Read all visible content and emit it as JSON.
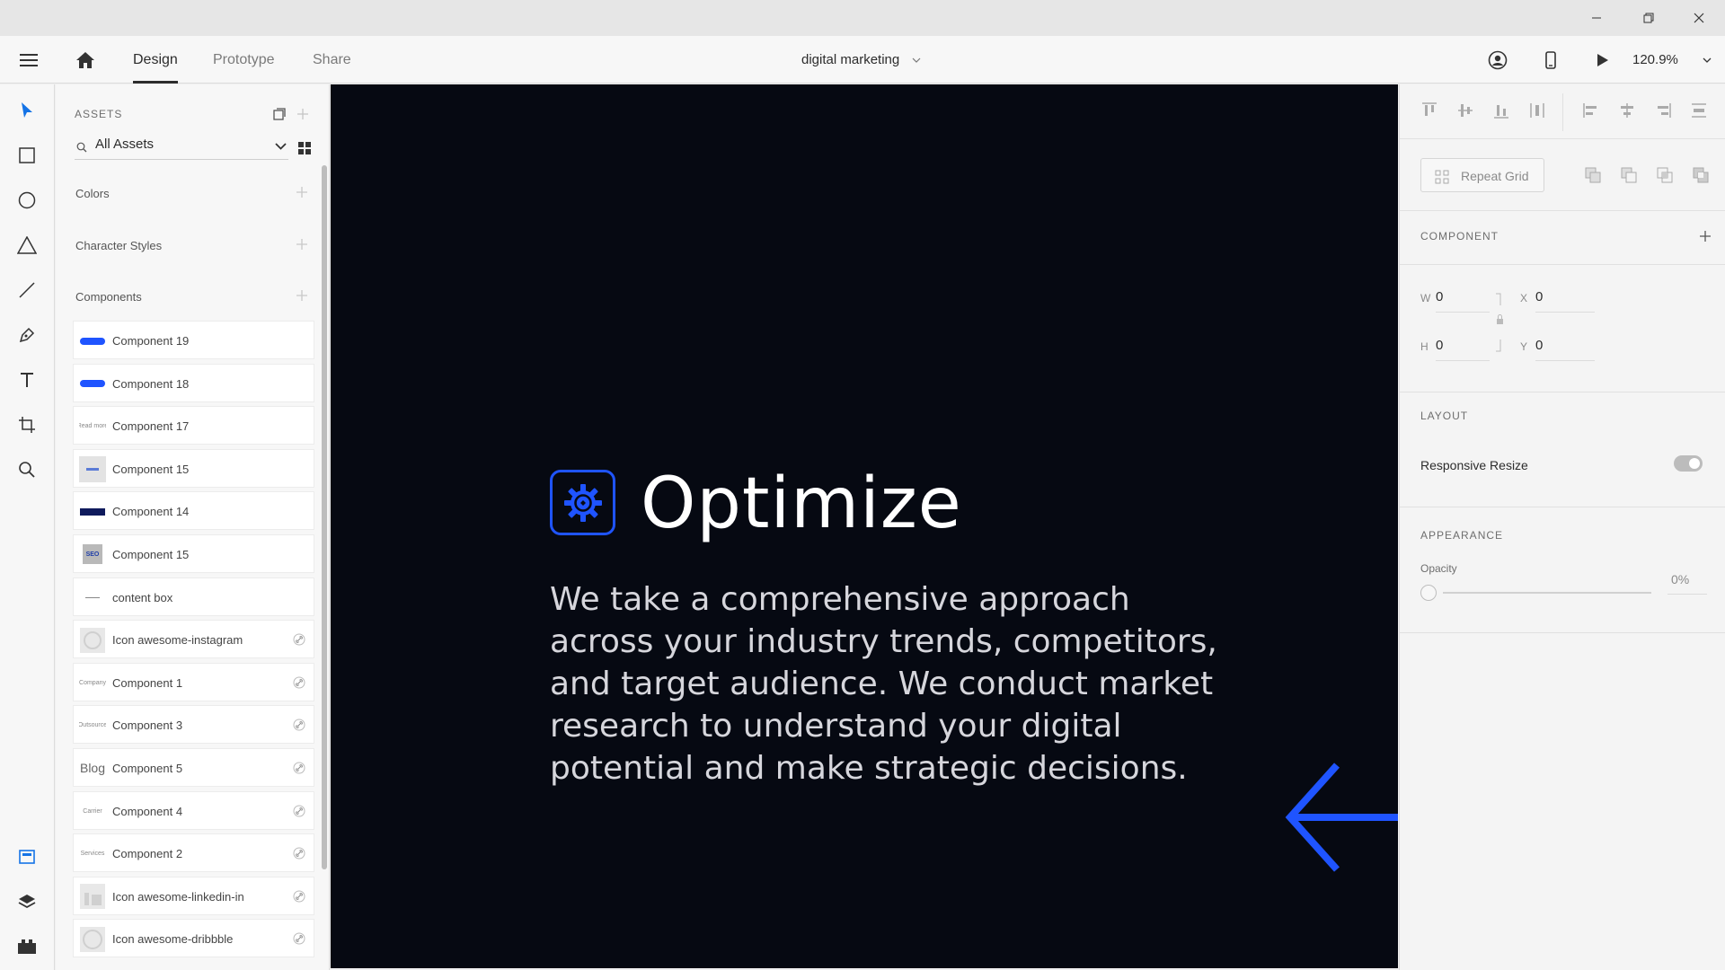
{
  "window": {
    "controls": [
      "minimize",
      "restore",
      "close"
    ]
  },
  "topnav": {
    "tabs": [
      {
        "label": "Design",
        "active": true
      },
      {
        "label": "Prototype",
        "active": false
      },
      {
        "label": "Share",
        "active": false
      }
    ],
    "document_title": "digital marketing",
    "zoom": "120.9%"
  },
  "tools": [
    "select-tool",
    "rectangle-tool",
    "ellipse-tool",
    "polygon-tool",
    "line-tool",
    "pen-tool",
    "text-tool",
    "artboard-tool",
    "zoom-tool"
  ],
  "bottom_tools": [
    "assets-panel",
    "layers-panel",
    "plugins-panel"
  ],
  "assets": {
    "heading": "ASSETS",
    "filter": "All Assets",
    "sections": {
      "colors": "Colors",
      "character_styles": "Character Styles",
      "components": "Components"
    },
    "components": [
      {
        "label": "Component 19",
        "thumb": "blue-pill",
        "linked": false
      },
      {
        "label": "Component 18",
        "thumb": "blue-pill",
        "linked": false
      },
      {
        "label": "Component 17",
        "thumb": "text",
        "thumb_text": "Read more",
        "linked": false
      },
      {
        "label": "Component 15",
        "thumb": "gray-card",
        "linked": false
      },
      {
        "label": "Component 14",
        "thumb": "navy-bar",
        "linked": false
      },
      {
        "label": "Component 15",
        "thumb": "seo",
        "thumb_text": "SEO",
        "linked": false
      },
      {
        "label": "content box",
        "thumb": "dash",
        "linked": false
      },
      {
        "label": "Icon awesome-instagram",
        "thumb": "instagram",
        "linked": true
      },
      {
        "label": "Component 1",
        "thumb": "text",
        "thumb_text": "Company",
        "linked": true
      },
      {
        "label": "Component 3",
        "thumb": "text",
        "thumb_text": "Outsource",
        "linked": true
      },
      {
        "label": "Component 5",
        "thumb": "text-large",
        "thumb_text": "Blog",
        "linked": true
      },
      {
        "label": "Component 4",
        "thumb": "text",
        "thumb_text": "Carrier",
        "linked": true
      },
      {
        "label": "Component 2",
        "thumb": "text",
        "thumb_text": "Services",
        "linked": true
      },
      {
        "label": "Icon awesome-linkedin-in",
        "thumb": "linkedin",
        "linked": true
      },
      {
        "label": "Icon awesome-dribbble",
        "thumb": "dribbble",
        "linked": true
      }
    ]
  },
  "canvas": {
    "heading": "Optimize",
    "body": "We take a comprehensive approach across your industry trends, competitors, and target audience. We conduct market research to understand your digital potential and make strategic decisions.",
    "accent_color": "#1f54ff",
    "background_color": "#060912"
  },
  "properties": {
    "repeat_grid": "Repeat Grid",
    "component_heading": "COMPONENT",
    "w_label": "W",
    "w_value": "0",
    "h_label": "H",
    "h_value": "0",
    "x_label": "X",
    "x_value": "0",
    "y_label": "Y",
    "y_value": "0",
    "layout_heading": "LAYOUT",
    "responsive_resize": "Responsive Resize",
    "responsive_resize_on": true,
    "appearance_heading": "APPEARANCE",
    "opacity_label": "Opacity",
    "opacity_value": "0%"
  }
}
